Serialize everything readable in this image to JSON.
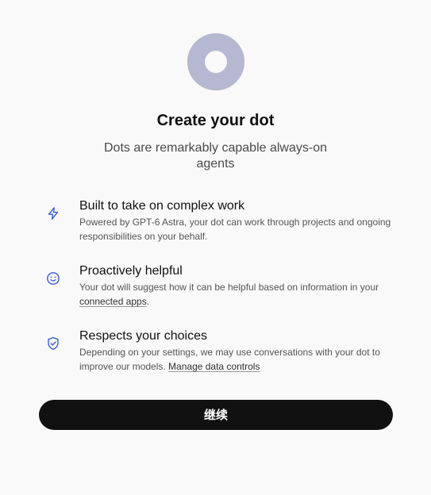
{
  "header": {
    "title": "Create your dot",
    "subtitle": "Dots are remarkably capable always-on agents"
  },
  "features": [
    {
      "icon": "lightning-icon",
      "title": "Built to take on complex work",
      "desc": "Powered by GPT-6 Astra, your dot can work through projects and ongoing responsibilities on your behalf."
    },
    {
      "icon": "smiley-icon",
      "title": "Proactively helpful",
      "desc_before": "Your dot will suggest how it can be helpful based on information in your ",
      "link": "connected apps",
      "desc_after": "."
    },
    {
      "icon": "shield-check-icon",
      "title": "Respects your choices",
      "desc_before": "Depending on your settings, we may use conversations with your dot to improve our models. ",
      "link": "Manage data controls",
      "desc_after": ""
    }
  ],
  "continue_label": "继续",
  "colors": {
    "background": "#f9f9fa",
    "logo": "#b5b8d0",
    "icon": "#3b5bdb",
    "button": "#111111"
  }
}
